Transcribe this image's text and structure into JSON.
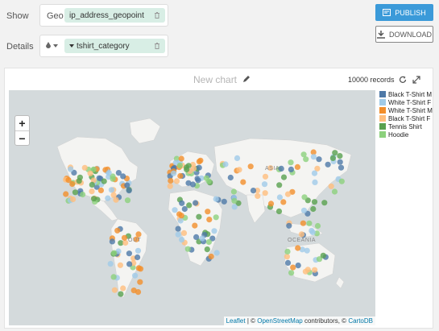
{
  "show": {
    "label": "Show",
    "type_label": "Geo",
    "field": "ip_address_geopoint"
  },
  "details": {
    "label": "Details",
    "field": "tshirt_category"
  },
  "buttons": {
    "publish": "PUBLISH",
    "download": "DOWNLOAD"
  },
  "chart": {
    "title": "New chart",
    "records": "10000 records"
  },
  "map": {
    "labels": [
      "ASIA",
      "OUT",
      "OCEANIA"
    ],
    "zoom_in": "+",
    "zoom_out": "−",
    "attribution": {
      "leaflet": "Leaflet",
      "sep1": " | © ",
      "osm": "OpenStreetMap",
      "mid": " contributors, © ",
      "carto": "CartoDB"
    }
  },
  "legend": [
    {
      "name": "Black T-Shirt M",
      "color": "#4e79a7"
    },
    {
      "name": "White T-Shirt F",
      "color": "#a0cbe8"
    },
    {
      "name": "White T-Shirt M",
      "color": "#f28e2b"
    },
    {
      "name": "Black T-Shirt F",
      "color": "#ffbe7d"
    },
    {
      "name": "Tennis Shirt",
      "color": "#59a14f"
    },
    {
      "name": "Hoodie",
      "color": "#8cd17d"
    }
  ]
}
